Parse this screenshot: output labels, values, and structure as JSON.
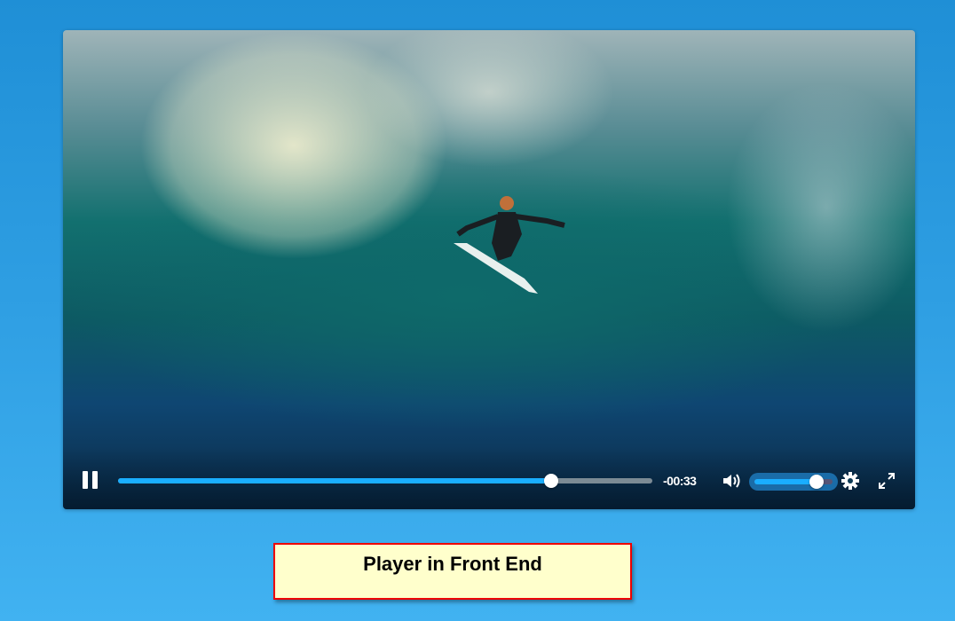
{
  "player": {
    "time_remaining": "-00:33",
    "progress_fraction": 0.81,
    "volume_fraction": 0.8,
    "state": "playing",
    "accent_color": "#1aaeff"
  },
  "caption": {
    "text": "Player in Front End"
  }
}
